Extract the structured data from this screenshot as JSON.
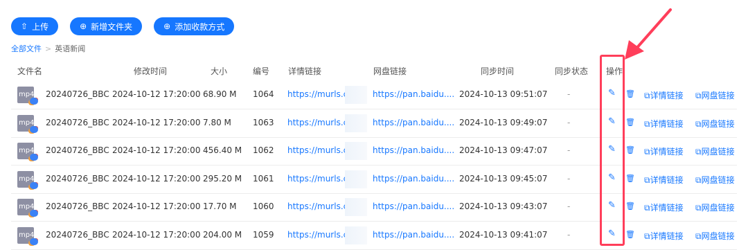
{
  "toolbar": {
    "upload_label": "上传",
    "new_folder_label": "新增文件夹",
    "add_payment_label": "添加收款方式",
    "upload_icon": "⇧",
    "plus_icon": "⊕"
  },
  "breadcrumb": {
    "root": "全部文件",
    "separator": ">",
    "current": "英语新闻"
  },
  "columns": {
    "name": "文件名",
    "modified": "修改时间",
    "size": "大小",
    "number": "编号",
    "detail_link": "详情链接",
    "pan_link": "网盘链接",
    "sync_time": "同步时间",
    "sync_status": "同步状态",
    "actions": "操作"
  },
  "file_icon_text": "mp4",
  "actions": {
    "edit_icon": "✎",
    "delete_icon": "🗑",
    "copy_icon": "⧉",
    "detail_label": "详情链接",
    "pan_label": "网盘链接"
  },
  "rows": [
    {
      "name": "20240726_BBC",
      "modified": "2024-10-12 17:20:00",
      "size": "68.90 M",
      "number": "1064",
      "detail": "https://murls.cn/",
      "pan": "https://pan.baidu....",
      "sync_time": "2024-10-13 09:51:07",
      "sync_status": "-"
    },
    {
      "name": "20240726_BBC",
      "modified": "2024-10-12 17:20:00",
      "size": "7.80 M",
      "number": "1063",
      "detail": "https://murls.cn/",
      "pan": "https://pan.baidu....",
      "sync_time": "2024-10-13 09:49:07",
      "sync_status": "-"
    },
    {
      "name": "20240726_BBC",
      "modified": "2024-10-12 17:20:00",
      "size": "456.40 M",
      "number": "1062",
      "detail": "https://murls.cn/",
      "pan": "https://pan.baidu....",
      "sync_time": "2024-10-13 09:47:07",
      "sync_status": "-"
    },
    {
      "name": "20240726_BBC",
      "modified": "2024-10-12 17:20:00",
      "size": "295.20 M",
      "number": "1061",
      "detail": "https://murls.cn/",
      "pan": "https://pan.baidu....",
      "sync_time": "2024-10-13 09:45:07",
      "sync_status": "-"
    },
    {
      "name": "20240726_BBC",
      "modified": "2024-10-12 17:20:00",
      "size": "17.70 M",
      "number": "1060",
      "detail": "https://murls.cn/",
      "pan": "https://pan.baidu....",
      "sync_time": "2024-10-13 09:43:07",
      "sync_status": "-"
    },
    {
      "name": "20240726_BBC",
      "modified": "2024-10-12 17:20:00",
      "size": "204.00 M",
      "number": "1059",
      "detail": "https://murls.cn/",
      "pan": "https://pan.baidu....",
      "sync_time": "2024-10-13 09:41:07",
      "sync_status": "-"
    }
  ],
  "colors": {
    "accent": "#1677ff",
    "highlight": "#ff3e5a",
    "file_icon_bg": "#8d8fa3"
  }
}
